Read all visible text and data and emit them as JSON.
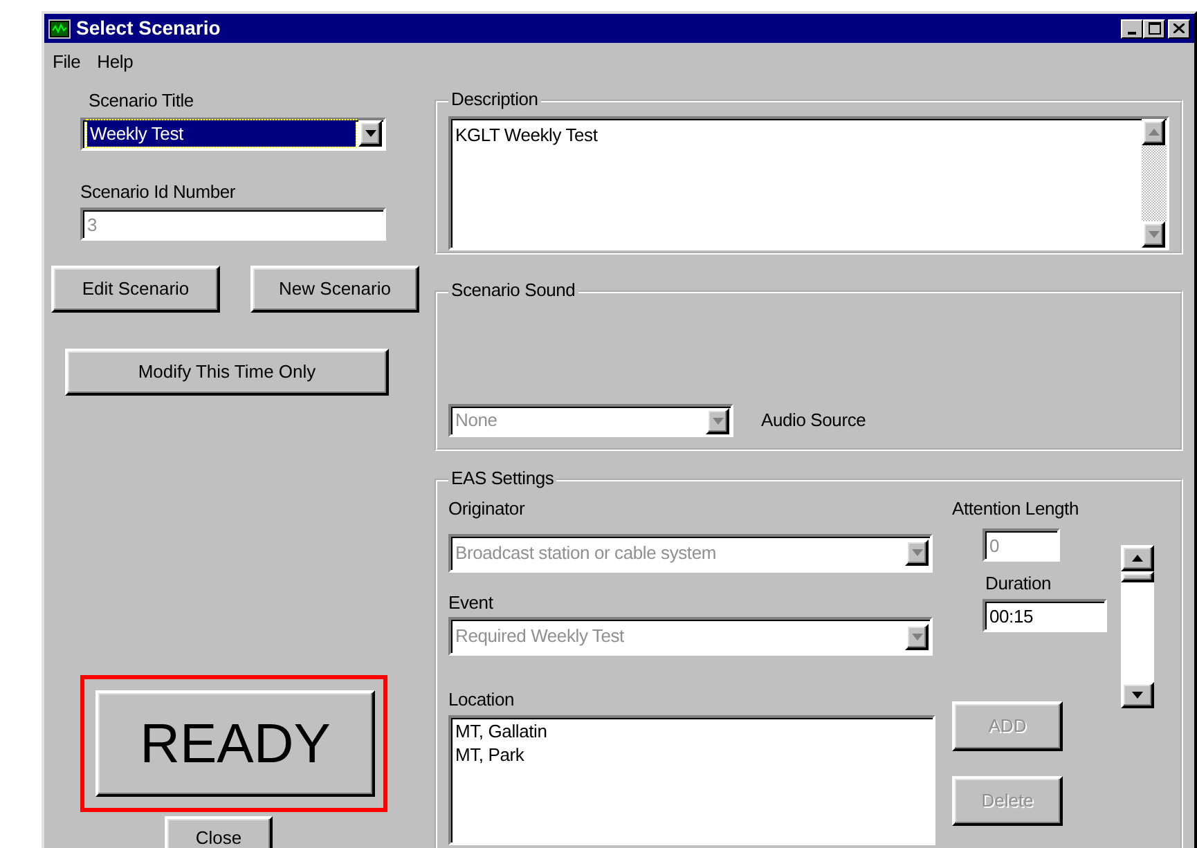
{
  "window": {
    "title": "Select Scenario"
  },
  "menu": [
    {
      "label": "File"
    },
    {
      "label": "Help"
    }
  ],
  "scenario_title": {
    "label": "Scenario Title",
    "value": "Weekly Test",
    "focused": true
  },
  "scenario_id": {
    "label": "Scenario Id Number",
    "value": "3",
    "disabled": true
  },
  "scenario_buttons": [
    {
      "label": "Edit Scenario"
    },
    {
      "label": "New Scenario"
    }
  ],
  "modify_button": {
    "label": "Modify This Time Only"
  },
  "ready_button": {
    "label": "READY",
    "highlighted": true
  },
  "close_button": {
    "label": "Close"
  },
  "description": {
    "title": "Description",
    "text": "KGLT Weekly Test"
  },
  "scenario_sound": {
    "title": "Scenario Sound",
    "audio_source": {
      "value": "None",
      "disabled": true
    },
    "audio_label": "Audio Source"
  },
  "eas_settings": {
    "title": "EAS Settings",
    "originator": {
      "label": "Originator",
      "value": "Broadcast station or cable system",
      "disabled": true
    },
    "event": {
      "label": "Event",
      "value": "Required Weekly Test",
      "disabled": true
    },
    "location": {
      "label": "Location",
      "items": [
        "MT, Gallatin",
        "MT, Park"
      ]
    },
    "attention_length": {
      "label": "Attention Length",
      "value": "0",
      "disabled": true
    },
    "duration": {
      "label": "Duration",
      "value": "00:15",
      "disabled": false
    },
    "add_button": {
      "label": "ADD",
      "disabled": true
    },
    "delete_button": {
      "label": "Delete",
      "disabled": true
    }
  }
}
